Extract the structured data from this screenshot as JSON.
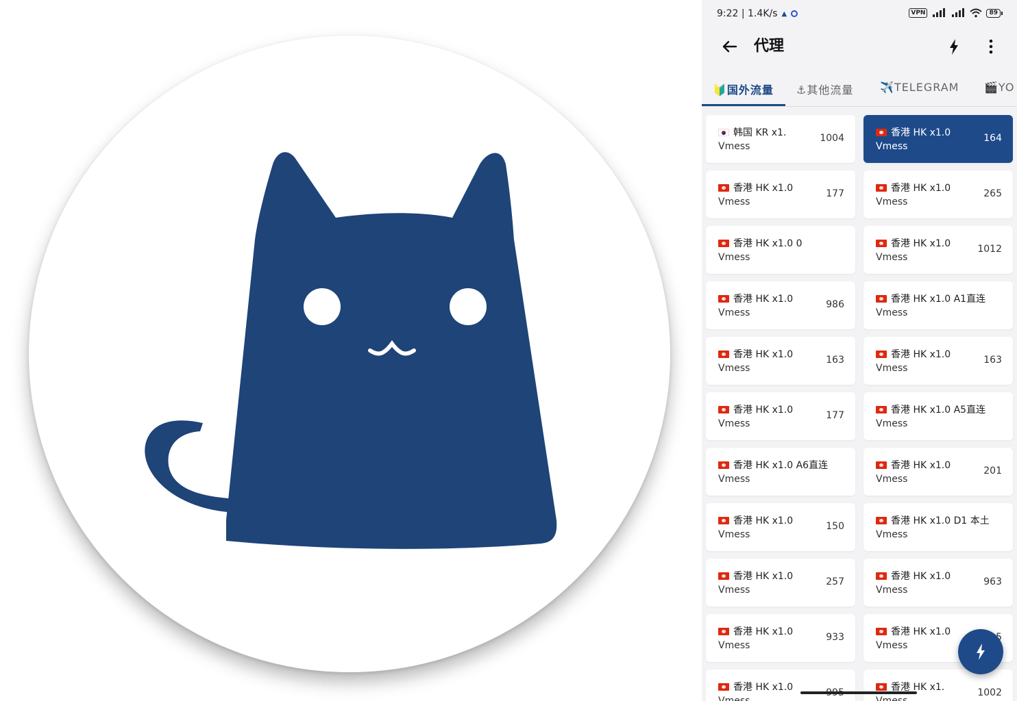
{
  "status_bar": {
    "time_speed": "9:22 | 1.4K/s",
    "vpn": "VPN",
    "battery": "89"
  },
  "app_bar": {
    "title": "代理"
  },
  "tabs": [
    {
      "label": "🔰国外流量",
      "active": true
    },
    {
      "label": "⚓其他流量",
      "active": false
    },
    {
      "label": "✈️TELEGRAM",
      "active": false
    },
    {
      "label": "🎬YO",
      "active": false
    }
  ],
  "proxies": [
    {
      "name": "韩国 KR x1.",
      "flag": "kr",
      "type": "Vmess",
      "delay": "1004",
      "selected": false
    },
    {
      "name": "香港 HK x1.0",
      "flag": "hk",
      "type": "Vmess",
      "delay": "164",
      "selected": true
    },
    {
      "name": "香港 HK x1.0",
      "flag": "hk",
      "type": "Vmess",
      "delay": "177",
      "selected": false
    },
    {
      "name": "香港 HK x1.0",
      "flag": "hk",
      "type": "Vmess",
      "delay": "265",
      "selected": false
    },
    {
      "name": "香港 HK x1.0 0",
      "flag": "hk",
      "type": "Vmess",
      "delay": "",
      "selected": false
    },
    {
      "name": "香港 HK x1.0",
      "flag": "hk",
      "type": "Vmess",
      "delay": "1012",
      "selected": false
    },
    {
      "name": "香港 HK x1.0",
      "flag": "hk",
      "type": "Vmess",
      "delay": "986",
      "selected": false
    },
    {
      "name": "香港 HK x1.0 A1直连",
      "flag": "hk",
      "type": "Vmess",
      "delay": "",
      "selected": false
    },
    {
      "name": "香港 HK x1.0",
      "flag": "hk",
      "type": "Vmess",
      "delay": "163",
      "selected": false
    },
    {
      "name": "香港 HK x1.0",
      "flag": "hk",
      "type": "Vmess",
      "delay": "163",
      "selected": false
    },
    {
      "name": "香港 HK x1.0",
      "flag": "hk",
      "type": "Vmess",
      "delay": "177",
      "selected": false
    },
    {
      "name": "香港 HK x1.0 A5直连",
      "flag": "hk",
      "type": "Vmess",
      "delay": "",
      "selected": false
    },
    {
      "name": "香港 HK x1.0 A6直连",
      "flag": "hk",
      "type": "Vmess",
      "delay": "",
      "selected": false
    },
    {
      "name": "香港 HK x1.0",
      "flag": "hk",
      "type": "Vmess",
      "delay": "201",
      "selected": false
    },
    {
      "name": "香港 HK x1.0",
      "flag": "hk",
      "type": "Vmess",
      "delay": "150",
      "selected": false
    },
    {
      "name": "香港 HK x1.0 D1 本土",
      "flag": "hk",
      "type": "Vmess",
      "delay": "",
      "selected": false
    },
    {
      "name": "香港 HK x1.0",
      "flag": "hk",
      "type": "Vmess",
      "delay": "257",
      "selected": false
    },
    {
      "name": "香港 HK x1.0",
      "flag": "hk",
      "type": "Vmess",
      "delay": "963",
      "selected": false
    },
    {
      "name": "香港 HK x1.0",
      "flag": "hk",
      "type": "Vmess",
      "delay": "933",
      "selected": false
    },
    {
      "name": "香港 HK x1.0",
      "flag": "hk",
      "type": "Vmess",
      "delay": "5",
      "selected": false
    },
    {
      "name": "香港 HK x1.0",
      "flag": "hk",
      "type": "Vmess",
      "delay": "995",
      "selected": false
    },
    {
      "name": "香港 HK x1.",
      "flag": "hk",
      "type": "Vmess",
      "delay": "1002",
      "selected": false
    }
  ],
  "colors": {
    "accent": "#1e4a8a",
    "background": "#f3f3f5",
    "card": "#ffffff"
  },
  "icons": {
    "back": "arrow-left-icon",
    "speed_test": "lightning-bolt-icon",
    "more": "more-vertical-icon",
    "fab": "lightning-bolt-icon"
  }
}
